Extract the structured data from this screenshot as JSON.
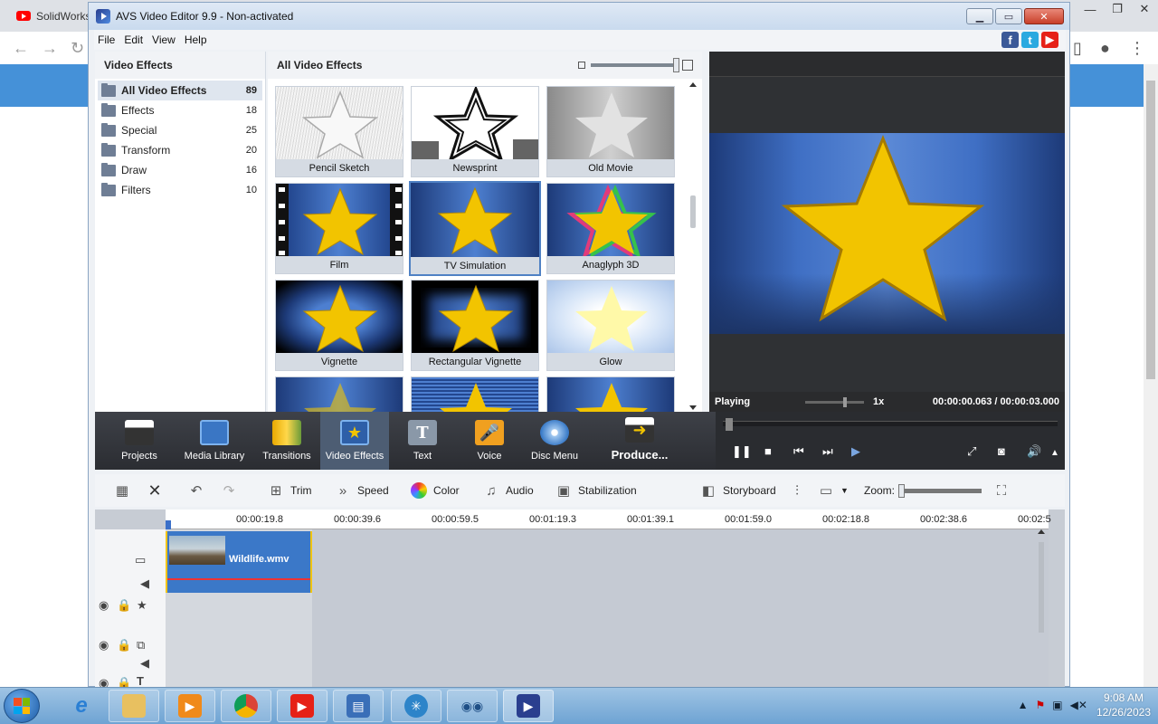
{
  "browser": {
    "tab_title": "SolidWorks",
    "window_controls": [
      "—",
      "❐",
      "✕"
    ],
    "nav_icons": [
      "←",
      "→",
      "↻"
    ]
  },
  "app": {
    "title": "AVS Video Editor 9.9 - Non-activated",
    "menu": [
      "File",
      "Edit",
      "View",
      "Help"
    ],
    "social": [
      "f",
      "t",
      "▶"
    ]
  },
  "left_panel": {
    "title": "Video Effects",
    "categories": [
      {
        "label": "All Video Effects",
        "count": "89"
      },
      {
        "label": "Effects",
        "count": "18"
      },
      {
        "label": "Special",
        "count": "25"
      },
      {
        "label": "Transform",
        "count": "20"
      },
      {
        "label": "Draw",
        "count": "16"
      },
      {
        "label": "Filters",
        "count": "10"
      }
    ]
  },
  "gallery": {
    "title": "All Video Effects",
    "effects": [
      "Pencil Sketch",
      "Newsprint",
      "Old Movie",
      "Film",
      "TV Simulation",
      "Anaglyph 3D",
      "Vignette",
      "Rectangular Vignette",
      "Glow"
    ]
  },
  "preview": {
    "status": "Playing",
    "speed": "1x",
    "time_current": "00:00:00.063",
    "time_separator": "/",
    "time_total": "00:00:03.000"
  },
  "ribbon": {
    "items": [
      "Projects",
      "Media Library",
      "Transitions",
      "Video Effects",
      "Text",
      "Voice",
      "Disc Menu",
      "Produce..."
    ],
    "selected": "Video Effects"
  },
  "timeline_toolbar": {
    "trim": "Trim",
    "speed": "Speed",
    "color": "Color",
    "audio": "Audio",
    "stabilization": "Stabilization",
    "storyboard": "Storyboard",
    "zoom": "Zoom:"
  },
  "timeline": {
    "ticks": [
      "00:00:19.8",
      "00:00:39.6",
      "00:00:59.5",
      "00:01:19.3",
      "00:01:39.1",
      "00:01:59.0",
      "00:02:18.8",
      "00:02:38.6",
      "00:02:5"
    ],
    "clip_name": "Wildlife.wmv"
  },
  "taskbar": {
    "time": "9:08 AM",
    "date": "12/26/2023"
  },
  "colors": {
    "ribbon_bg": "#2b2d32",
    "selected_accent": "#4f81c4",
    "star": "#f2c400",
    "clip": "#3b78c8"
  }
}
